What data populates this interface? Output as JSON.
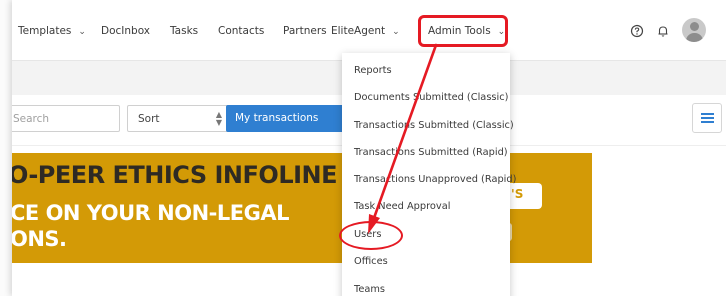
{
  "nav": {
    "items": [
      {
        "key": "templates",
        "label": "Templates",
        "caret": true
      },
      {
        "key": "docinbox",
        "label": "DocInbox",
        "caret": false
      },
      {
        "key": "tasks",
        "label": "Tasks",
        "caret": false
      },
      {
        "key": "contacts",
        "label": "Contacts",
        "caret": false
      },
      {
        "key": "partners",
        "label": "Partners",
        "caret": false
      },
      {
        "key": "eliteagent",
        "label": "EliteAgent",
        "caret": true
      },
      {
        "key": "admintools",
        "label": "Admin Tools",
        "caret": true
      }
    ],
    "help_icon": "help-circle-icon",
    "bell_icon": "bell-icon",
    "avatar_icon": "user-avatar-icon"
  },
  "toolbar": {
    "search_placeholder": "Search",
    "sort_label": "Sort",
    "my_transactions_label": "My transactions",
    "list_icon": "list-view-icon",
    "accent": "#2f7fd1"
  },
  "banner": {
    "line1": "O-PEER ETHICS INFOLINE",
    "line2": "CE ON YOUR NON-LEGAL",
    "line3": "ONS.",
    "pill_text": "R.'S",
    "bg": "#d39a06"
  },
  "admin_menu": {
    "items": [
      "Reports",
      "Documents Submitted (Classic)",
      "Transactions Submitted (Classic)",
      "Transactions Submitted (Rapid)",
      "Transactions Unapproved (Rapid)",
      "Task Need Approval",
      "Users",
      "Offices",
      "Teams"
    ]
  },
  "annotation": {
    "color": "#e51a23"
  }
}
